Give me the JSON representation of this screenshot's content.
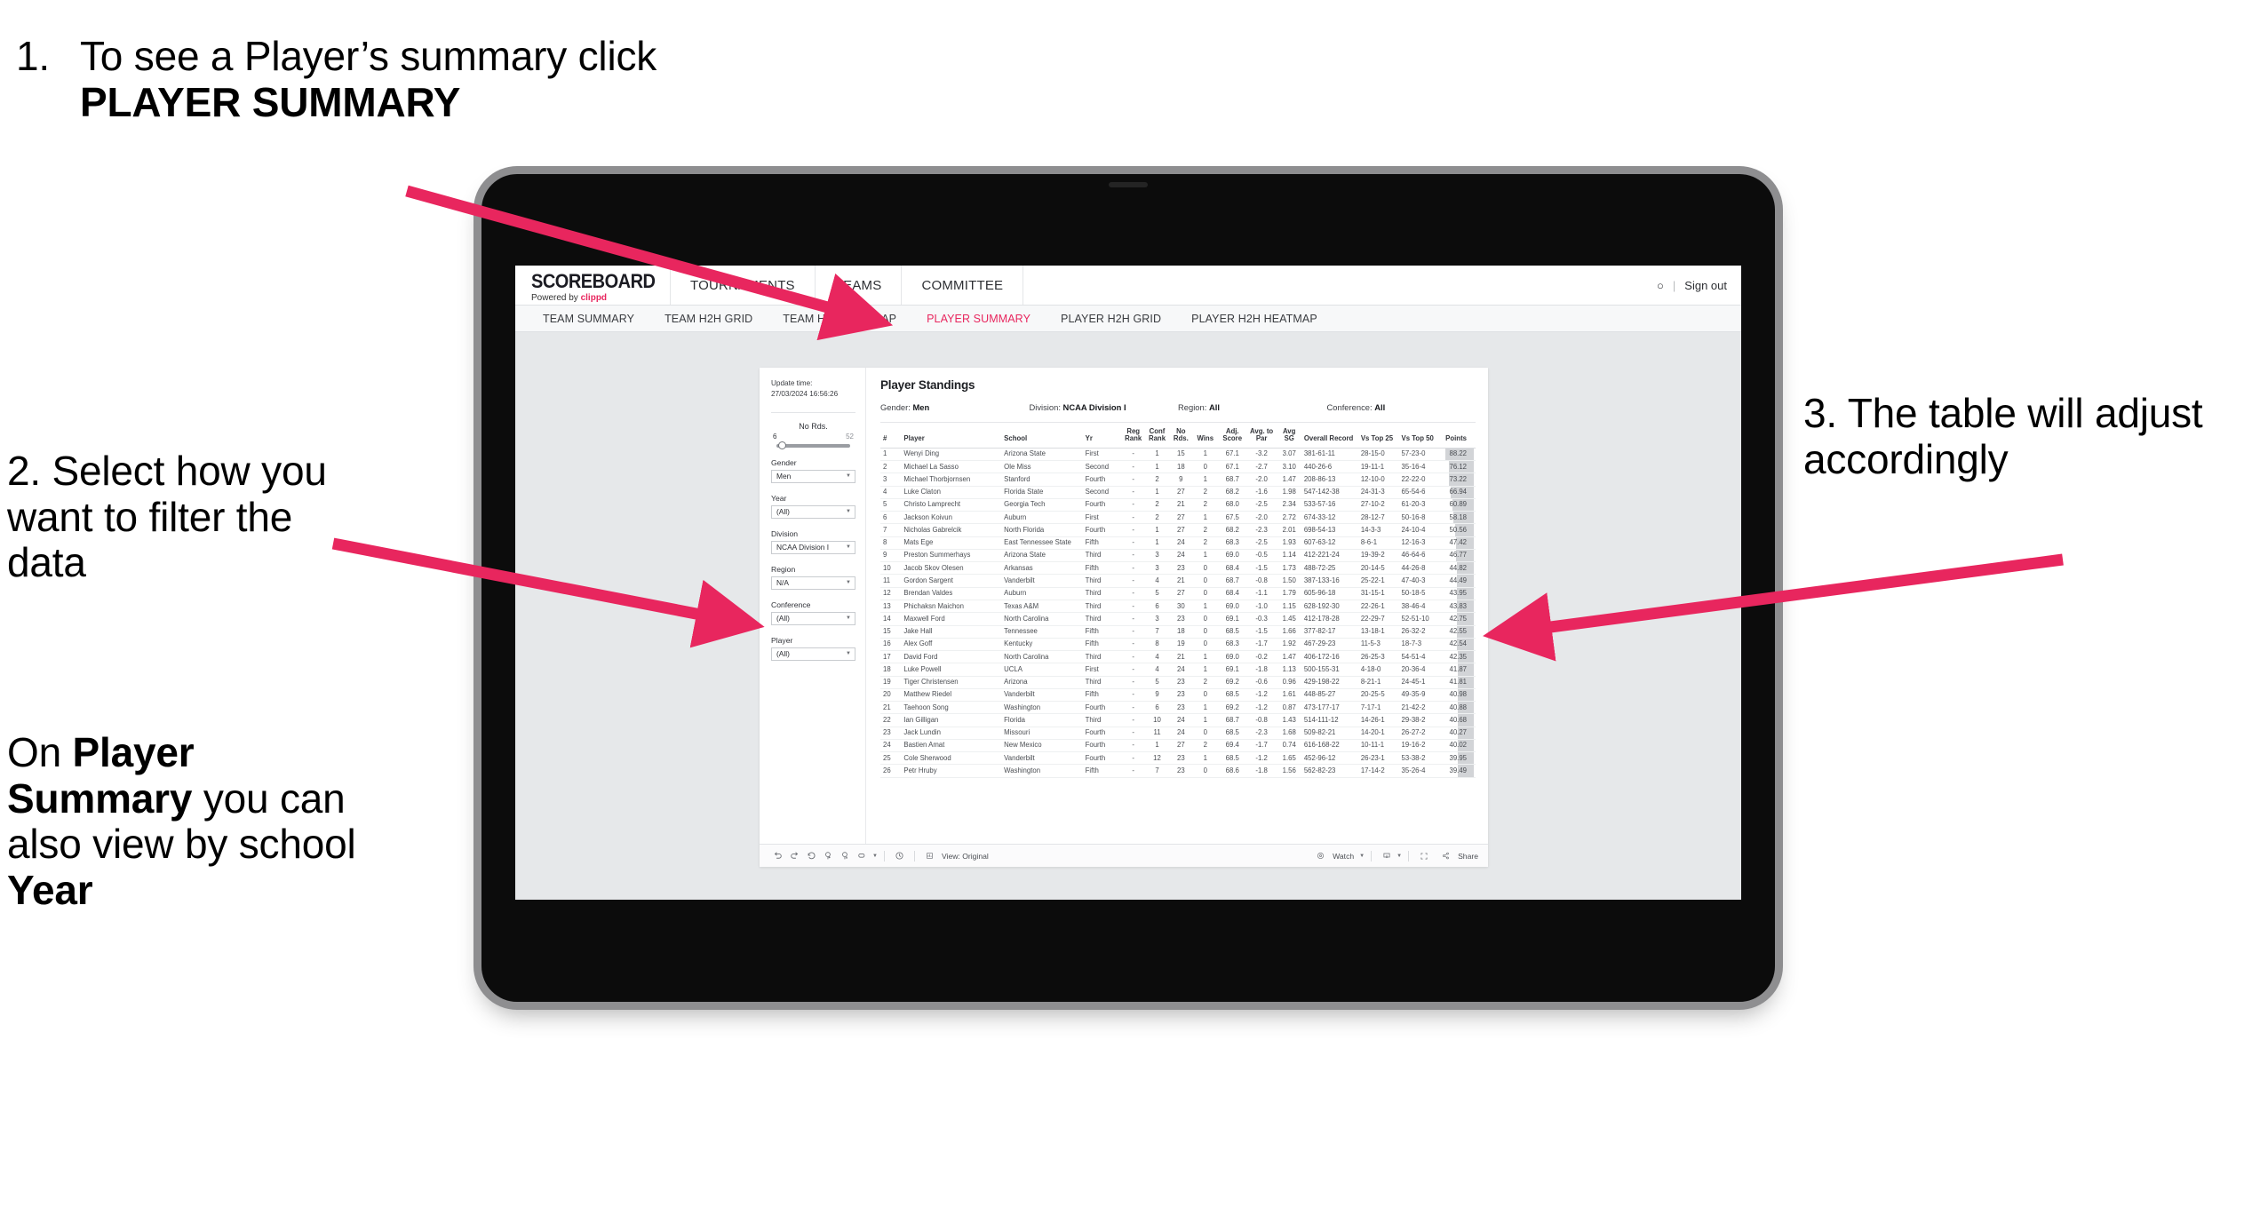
{
  "annotations": {
    "one": {
      "number": "1.",
      "text_before": "To see a Player’s summary click ",
      "bold": "PLAYER SUMMARY"
    },
    "two": {
      "line": "2. Select how you want to filter the data"
    },
    "two_b": {
      "prefix": "On ",
      "bold1": "Player Summary",
      "mid": " you can also view by school ",
      "bold2": "Year"
    },
    "three": {
      "line": "3. The table will adjust accordingly"
    }
  },
  "colors": {
    "accent": "#e8265e",
    "arrow": "#e8265e",
    "brand_pink": "#e8265e"
  },
  "browser": {
    "logo": {
      "word": "SCOREBOARD",
      "powered_prefix": "Powered by ",
      "brand": "clippd"
    },
    "topnav": [
      "TOURNAMENTS",
      "TEAMS",
      "COMMITTEE"
    ],
    "account": {
      "user_glyph": "○",
      "separator": "|",
      "sign_out": "Sign out"
    },
    "subnav": {
      "items": [
        "TEAM SUMMARY",
        "TEAM H2H GRID",
        "TEAM H2H HEATMAP",
        "PLAYER SUMMARY",
        "PLAYER H2H GRID",
        "PLAYER H2H HEATMAP"
      ],
      "active": "PLAYER SUMMARY"
    }
  },
  "viz": {
    "update_time_label": "Update time:",
    "update_time_value": "27/03/2024 16:56:26",
    "slider": {
      "label": "No Rds.",
      "min": "6",
      "max": "52"
    },
    "filters": [
      {
        "label": "Gender",
        "value": "Men"
      },
      {
        "label": "Year",
        "value": "(All)"
      },
      {
        "label": "Division",
        "value": "NCAA Division I"
      },
      {
        "label": "Region",
        "value": "N/A"
      },
      {
        "label": "Conference",
        "value": "(All)"
      },
      {
        "label": "Player",
        "value": "(All)"
      }
    ],
    "title": "Player Standings",
    "summary": [
      {
        "label": "Gender:",
        "value": "Men"
      },
      {
        "label": "Division:",
        "value": "NCAA Division I"
      },
      {
        "label": "Region:",
        "value": "All"
      },
      {
        "label": "Conference:",
        "value": "All"
      }
    ],
    "toolbar": {
      "view_label": "View: Original",
      "watch_label": "Watch",
      "share_label": "Share"
    }
  },
  "chart_data": {
    "type": "table",
    "title": "Player Standings",
    "columns": [
      "#",
      "Player",
      "School",
      "Yr",
      "Reg Rank",
      "Conf Rank",
      "No Rds.",
      "Wins",
      "Adj. Score",
      "Avg. to Par",
      "Avg SG",
      "Overall Record",
      "Vs Top 25",
      "Vs Top 50",
      "Points"
    ],
    "points_max": 88.22,
    "rows": [
      [
        "1",
        "Wenyi Ding",
        "Arizona State",
        "First",
        "-",
        "1",
        "15",
        "1",
        "67.1",
        "-3.2",
        "3.07",
        "381-61-11",
        "28-15-0",
        "57-23-0",
        "88.22"
      ],
      [
        "2",
        "Michael La Sasso",
        "Ole Miss",
        "Second",
        "-",
        "1",
        "18",
        "0",
        "67.1",
        "-2.7",
        "3.10",
        "440-26-6",
        "19-11-1",
        "35-16-4",
        "76.12"
      ],
      [
        "3",
        "Michael Thorbjornsen",
        "Stanford",
        "Fourth",
        "-",
        "2",
        "9",
        "1",
        "68.7",
        "-2.0",
        "1.47",
        "208-86-13",
        "12-10-0",
        "22-22-0",
        "73.22"
      ],
      [
        "4",
        "Luke Claton",
        "Florida State",
        "Second",
        "-",
        "1",
        "27",
        "2",
        "68.2",
        "-1.6",
        "1.98",
        "547-142-38",
        "24-31-3",
        "65-54-6",
        "66.94"
      ],
      [
        "5",
        "Christo Lamprecht",
        "Georgia Tech",
        "Fourth",
        "-",
        "2",
        "21",
        "2",
        "68.0",
        "-2.5",
        "2.34",
        "533-57-16",
        "27-10-2",
        "61-20-3",
        "60.89"
      ],
      [
        "6",
        "Jackson Koivun",
        "Auburn",
        "First",
        "-",
        "2",
        "27",
        "1",
        "67.5",
        "-2.0",
        "2.72",
        "674-33-12",
        "28-12-7",
        "50-16-8",
        "58.18"
      ],
      [
        "7",
        "Nicholas Gabrelcik",
        "North Florida",
        "Fourth",
        "-",
        "1",
        "27",
        "2",
        "68.2",
        "-2.3",
        "2.01",
        "698-54-13",
        "14-3-3",
        "24-10-4",
        "50.56"
      ],
      [
        "8",
        "Mats Ege",
        "East Tennessee State",
        "Fifth",
        "-",
        "1",
        "24",
        "2",
        "68.3",
        "-2.5",
        "1.93",
        "607-63-12",
        "8-6-1",
        "12-16-3",
        "47.42"
      ],
      [
        "9",
        "Preston Summerhays",
        "Arizona State",
        "Third",
        "-",
        "3",
        "24",
        "1",
        "69.0",
        "-0.5",
        "1.14",
        "412-221-24",
        "19-39-2",
        "46-64-6",
        "46.77"
      ],
      [
        "10",
        "Jacob Skov Olesen",
        "Arkansas",
        "Fifth",
        "-",
        "3",
        "23",
        "0",
        "68.4",
        "-1.5",
        "1.73",
        "488-72-25",
        "20-14-5",
        "44-26-8",
        "44.82"
      ],
      [
        "11",
        "Gordon Sargent",
        "Vanderbilt",
        "Third",
        "-",
        "4",
        "21",
        "0",
        "68.7",
        "-0.8",
        "1.50",
        "387-133-16",
        "25-22-1",
        "47-40-3",
        "44.49"
      ],
      [
        "12",
        "Brendan Valdes",
        "Auburn",
        "Third",
        "-",
        "5",
        "27",
        "0",
        "68.4",
        "-1.1",
        "1.79",
        "605-96-18",
        "31-15-1",
        "50-18-5",
        "43.95"
      ],
      [
        "13",
        "Phichaksn Maichon",
        "Texas A&M",
        "Third",
        "-",
        "6",
        "30",
        "1",
        "69.0",
        "-1.0",
        "1.15",
        "628-192-30",
        "22-26-1",
        "38-46-4",
        "43.83"
      ],
      [
        "14",
        "Maxwell Ford",
        "North Carolina",
        "Third",
        "-",
        "3",
        "23",
        "0",
        "69.1",
        "-0.3",
        "1.45",
        "412-178-28",
        "22-29-7",
        "52-51-10",
        "42.75"
      ],
      [
        "15",
        "Jake Hall",
        "Tennessee",
        "Fifth",
        "-",
        "7",
        "18",
        "0",
        "68.5",
        "-1.5",
        "1.66",
        "377-82-17",
        "13-18-1",
        "26-32-2",
        "42.55"
      ],
      [
        "16",
        "Alex Goff",
        "Kentucky",
        "Fifth",
        "-",
        "8",
        "19",
        "0",
        "68.3",
        "-1.7",
        "1.92",
        "467-29-23",
        "11-5-3",
        "18-7-3",
        "42.54"
      ],
      [
        "17",
        "David Ford",
        "North Carolina",
        "Third",
        "-",
        "4",
        "21",
        "1",
        "69.0",
        "-0.2",
        "1.47",
        "406-172-16",
        "26-25-3",
        "54-51-4",
        "42.35"
      ],
      [
        "18",
        "Luke Powell",
        "UCLA",
        "First",
        "-",
        "4",
        "24",
        "1",
        "69.1",
        "-1.8",
        "1.13",
        "500-155-31",
        "4-18-0",
        "20-36-4",
        "41.87"
      ],
      [
        "19",
        "Tiger Christensen",
        "Arizona",
        "Third",
        "-",
        "5",
        "23",
        "2",
        "69.2",
        "-0.6",
        "0.96",
        "429-198-22",
        "8-21-1",
        "24-45-1",
        "41.81"
      ],
      [
        "20",
        "Matthew Riedel",
        "Vanderbilt",
        "Fifth",
        "-",
        "9",
        "23",
        "0",
        "68.5",
        "-1.2",
        "1.61",
        "448-85-27",
        "20-25-5",
        "49-35-9",
        "40.98"
      ],
      [
        "21",
        "Taehoon Song",
        "Washington",
        "Fourth",
        "-",
        "6",
        "23",
        "1",
        "69.2",
        "-1.2",
        "0.87",
        "473-177-17",
        "7-17-1",
        "21-42-2",
        "40.88"
      ],
      [
        "22",
        "Ian Gilligan",
        "Florida",
        "Third",
        "-",
        "10",
        "24",
        "1",
        "68.7",
        "-0.8",
        "1.43",
        "514-111-12",
        "14-26-1",
        "29-38-2",
        "40.68"
      ],
      [
        "23",
        "Jack Lundin",
        "Missouri",
        "Fourth",
        "-",
        "11",
        "24",
        "0",
        "68.5",
        "-2.3",
        "1.68",
        "509-82-21",
        "14-20-1",
        "26-27-2",
        "40.27"
      ],
      [
        "24",
        "Bastien Amat",
        "New Mexico",
        "Fourth",
        "-",
        "1",
        "27",
        "2",
        "69.4",
        "-1.7",
        "0.74",
        "616-168-22",
        "10-11-1",
        "19-16-2",
        "40.02"
      ],
      [
        "25",
        "Cole Sherwood",
        "Vanderbilt",
        "Fourth",
        "-",
        "12",
        "23",
        "1",
        "68.5",
        "-1.2",
        "1.65",
        "452-96-12",
        "26-23-1",
        "53-38-2",
        "39.95"
      ],
      [
        "26",
        "Petr Hruby",
        "Washington",
        "Fifth",
        "-",
        "7",
        "23",
        "0",
        "68.6",
        "-1.8",
        "1.56",
        "562-82-23",
        "17-14-2",
        "35-26-4",
        "39.49"
      ]
    ]
  }
}
